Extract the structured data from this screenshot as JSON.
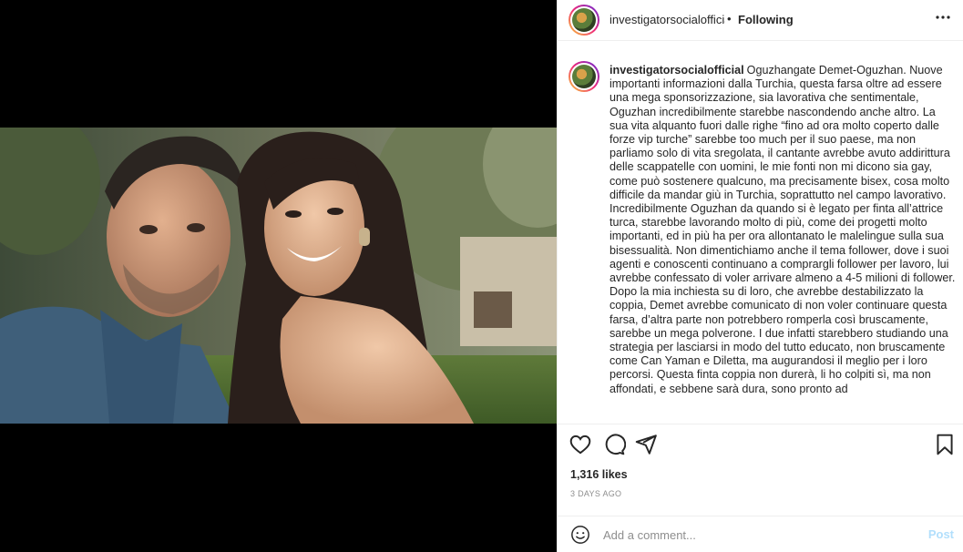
{
  "post": {
    "username": "investigatorsocialofficial",
    "follow_status": "Following",
    "header_separator": "•",
    "more_icon": "more-horizontal-icon",
    "caption_username": "investigatorsocialofficial",
    "caption_text": "Oguzhangate Demet-Oguzhan. Nuove importanti informazioni dalla Turchia, questa farsa oltre ad essere una mega sponsorizzazione, sia lavorativa che sentimentale, Oguzhan incredibilmente starebbe nascondendo anche altro. La sua vita alquanto fuori dalle righe “fino ad ora molto coperto dalle forze vip turche” sarebbe too much per il suo paese, ma non parliamo solo di vita sregolata, il cantante avrebbe avuto addirittura delle scappatelle con uomini, le mie fonti non mi dicono sia gay, come può sostenere qualcuno, ma precisamente bisex, cosa molto difficile da mandar giù in Turchia, soprattutto nel campo lavorativo. Incredibilmente Oguzhan da quando si è legato per finta all’attrice turca, starebbe lavorando molto di più, come dei progetti molto importanti, ed in più ha per ora allontanato le malelingue sulla sua bisessualità. Non dimentichiamo anche il tema follower, dove i suoi agenti e conoscenti continuano a comprargli follower per lavoro, lui avrebbe confessato di voler arrivare almeno a 4-5 milioni di follower. Dopo la mia inchiesta su di loro, che avrebbe destabilizzato la coppia, Demet avrebbe comunicato di non voler continuare questa farsa, d’altra parte non potrebbero romperla così bruscamente, sarebbe un mega polverone. I due infatti starebbero studiando una strategia per lasciarsi in modo del tutto educato, non bruscamente come Can Yaman e Diletta, ma augurandosi il meglio per i loro percorsi. Questa finta coppia non durerà, li ho colpiti sì, ma non affondati, e sebbene sarà dura, sono pronto ad",
    "likes": "1,316 likes",
    "date": "3 DAYS AGO",
    "comment_placeholder": "Add a comment...",
    "post_button": "Post"
  },
  "icons": {
    "like": "heart-icon",
    "comment": "comment-icon",
    "share": "send-icon",
    "save": "bookmark-icon",
    "emoji": "emoji-icon"
  },
  "colors": {
    "text": "#262626",
    "muted": "#8e8e8e",
    "post_disabled": "#b2dffc",
    "divider": "#efefef"
  }
}
